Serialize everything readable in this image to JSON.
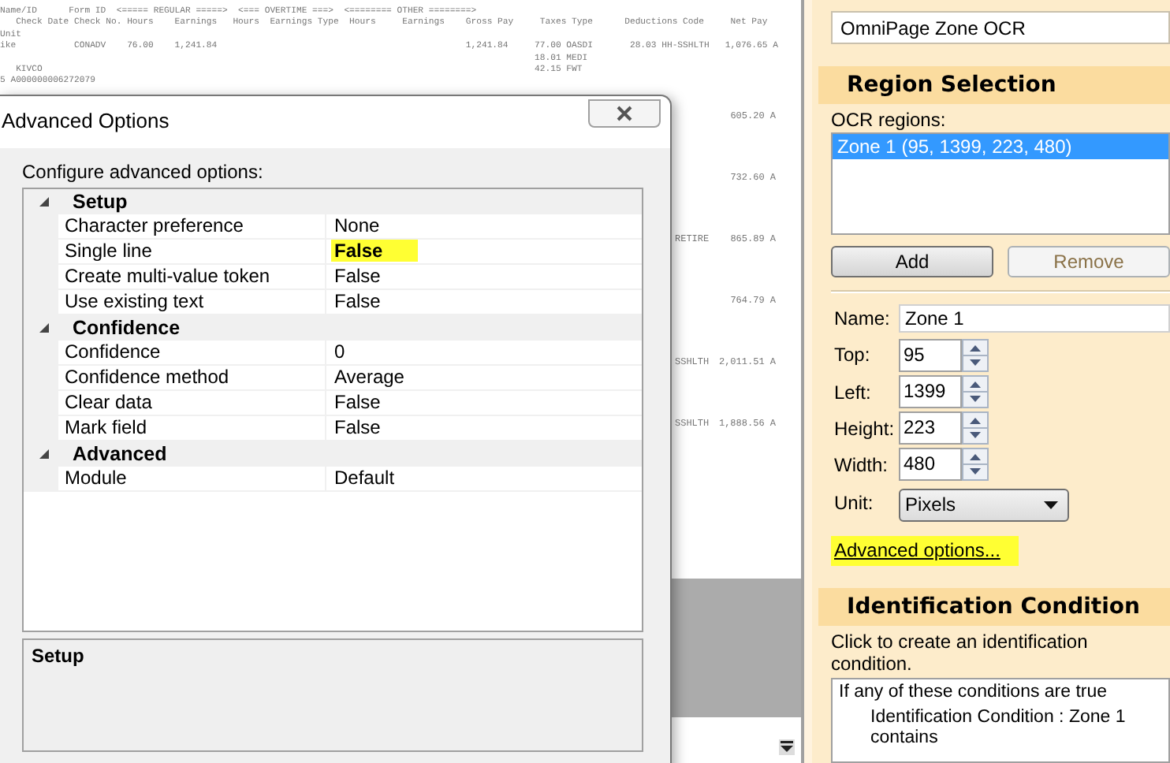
{
  "document": {
    "lines": [
      "Name/ID      Form ID  <===== REGULAR =====>  <=== OVERTIME ===>  <======== OTHER ========>",
      "   Check Date Check No. Hours    Earnings   Hours  Earnings Type  Hours     Earnings    Gross Pay     Taxes Type      Deductions Code     Net Pay",
      "Unit",
      "ike           CONADV    76.00    1,241.84                                               1,241.84     77.00 OASDI       28.03 HH-SSHLTH   1,076.65 A",
      "                                                                                                     18.01 MEDI",
      "   KIVCO                                                                                             42.15 FWT",
      "5 A000000006272079"
    ],
    "right_entries": [
      {
        "amount": "605.20 A"
      },
      {
        "amount": "732.60 A"
      },
      {
        "code": "RETIRE",
        "amount": "865.89 A"
      },
      {
        "amount": "764.79 A"
      },
      {
        "code": "SSHLTH",
        "amount": "2,011.51 A"
      },
      {
        "code": "SSHLTH",
        "amount": "1,888.56 A"
      }
    ]
  },
  "dialog": {
    "title": "Advanced Options",
    "prompt": "Configure advanced options:",
    "categories": [
      {
        "name": "Setup",
        "expanded": true,
        "items": [
          {
            "name": "Character preference",
            "value": "None",
            "highlighted": false
          },
          {
            "name": "Single line",
            "value": "False",
            "highlighted": true
          },
          {
            "name": "Create multi-value token",
            "value": "False",
            "highlighted": false
          },
          {
            "name": "Use existing text",
            "value": "False",
            "highlighted": false
          }
        ]
      },
      {
        "name": "Confidence",
        "expanded": true,
        "items": [
          {
            "name": "Confidence",
            "value": "0",
            "highlighted": false
          },
          {
            "name": "Confidence method",
            "value": "Average",
            "highlighted": false
          },
          {
            "name": "Clear data",
            "value": "False",
            "highlighted": false
          },
          {
            "name": "Mark field",
            "value": "False",
            "highlighted": false
          }
        ]
      },
      {
        "name": "Advanced",
        "expanded": true,
        "items": [
          {
            "name": "Module",
            "value": "Default",
            "highlighted": false
          }
        ]
      }
    ],
    "description_title": "Setup"
  },
  "panel": {
    "engine": "OmniPage Zone OCR",
    "region_header": "Region Selection",
    "regions_label": "OCR regions:",
    "regions": [
      {
        "label": "Zone 1 (95, 1399, 223, 480)",
        "selected": true
      }
    ],
    "buttons": [
      {
        "label": "Add",
        "disabled": false
      },
      {
        "label": "Remove",
        "disabled": true
      }
    ],
    "fields": [
      {
        "label": "Name:",
        "value": "Zone 1",
        "kind": "text"
      },
      {
        "label": "Top:",
        "value": "95",
        "kind": "spin"
      },
      {
        "label": "Left:",
        "value": "1399",
        "kind": "spin"
      },
      {
        "label": "Height:",
        "value": "223",
        "kind": "spin"
      },
      {
        "label": "Width:",
        "value": "480",
        "kind": "spin"
      },
      {
        "label": "Unit:",
        "value": "Pixels",
        "kind": "dropdown"
      }
    ],
    "advanced_link": {
      "label": "Advanced options...",
      "highlighted": true
    },
    "condition_header": "Identification Condition",
    "condition_hint": "Click to create an identification condition.",
    "conditions": {
      "title": "If any of these conditions are true",
      "items": [
        "Identification Condition : Zone 1 contains"
      ]
    }
  }
}
